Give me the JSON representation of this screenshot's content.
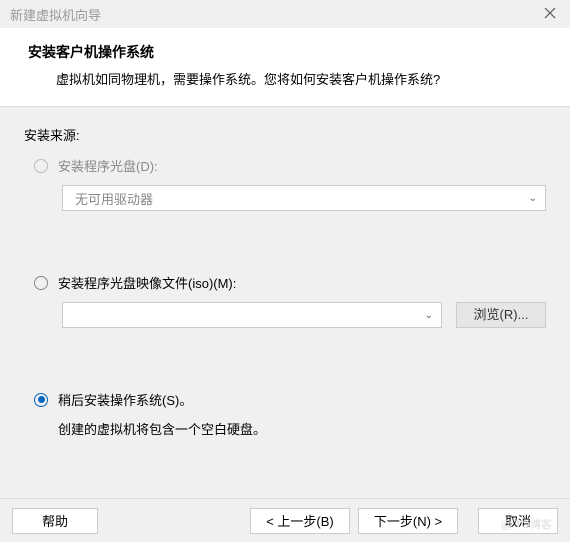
{
  "window": {
    "title": "新建虚拟机向导"
  },
  "header": {
    "title": "安装客户机操作系统",
    "subtitle": "虚拟机如同物理机，需要操作系统。您将如何安装客户机操作系统?"
  },
  "source_label": "安装来源:",
  "options": {
    "disc": {
      "label": "安装程序光盘(D):",
      "drive": "无可用驱动器"
    },
    "iso": {
      "label": "安装程序光盘映像文件(iso)(M):",
      "browse": "浏览(R)..."
    },
    "later": {
      "label": "稍后安装操作系统(S)。",
      "note": "创建的虚拟机将包含一个空白硬盘。"
    }
  },
  "footer": {
    "help": "帮助",
    "back": "< 上一步(B)",
    "next": "下一步(N) >",
    "cancel": "取消"
  },
  "watermark": "@  TO博客"
}
